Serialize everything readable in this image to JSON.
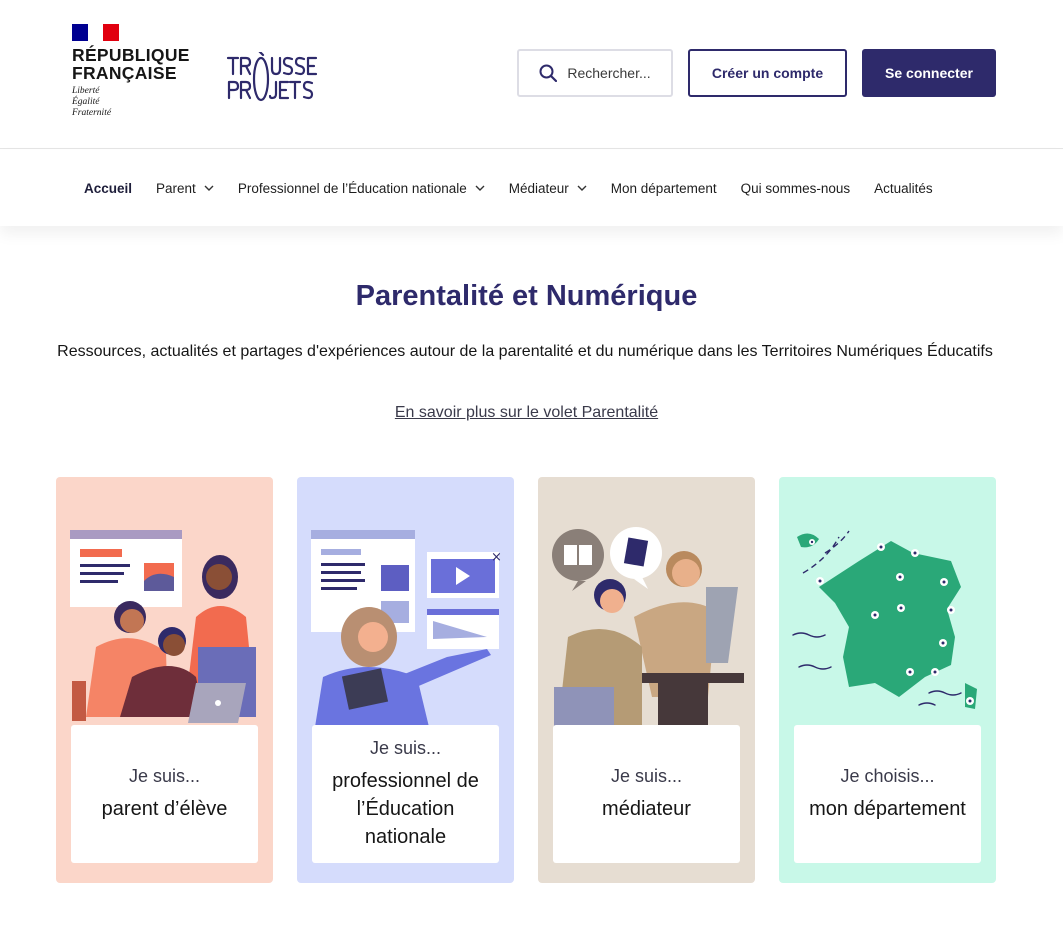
{
  "header": {
    "rf_title_line1": "RÉPUBLIQUE",
    "rf_title_line2": "FRANÇAISE",
    "rf_motto_1": "Liberté",
    "rf_motto_2": "Égalité",
    "rf_motto_3": "Fraternité",
    "search_label": "Rechercher...",
    "create_account_label": "Créer un compte",
    "login_label": "Se connecter",
    "flag_colors": [
      "#000091",
      "#ffffff",
      "#e1000f"
    ],
    "brand_color": "#2e2a6b"
  },
  "nav": {
    "items": [
      {
        "label": "Accueil",
        "dropdown": false,
        "active": true
      },
      {
        "label": "Parent",
        "dropdown": true
      },
      {
        "label": "Professionnel de l’Éducation nationale",
        "dropdown": true
      },
      {
        "label": "Médiateur",
        "dropdown": true
      },
      {
        "label": "Mon département",
        "dropdown": false
      },
      {
        "label": "Qui sommes-nous",
        "dropdown": false
      },
      {
        "label": "Actualités",
        "dropdown": false
      }
    ]
  },
  "hero": {
    "title": "Parentalité et Numérique",
    "subtitle": "Ressources, actualités et partages d'expériences autour de la parentalité et du numérique dans les Territoires Numériques Éducatifs",
    "link": "En savoir plus sur le volet Parentalité"
  },
  "cards": [
    {
      "pre": "Je suis...",
      "main": "parent d’élève",
      "bg": "#fbd6c9",
      "icon": "parent-illustration"
    },
    {
      "pre": "Je suis...",
      "main": "professionnel de l’Éducation nationale",
      "bg": "#d5dcfc",
      "icon": "teacher-illustration"
    },
    {
      "pre": "Je suis...",
      "main": "médiateur",
      "bg": "#e6ddd2",
      "icon": "mediator-illustration"
    },
    {
      "pre": "Je choisis...",
      "main": "mon département",
      "bg": "#c8f8e8",
      "icon": "france-map-illustration"
    }
  ]
}
